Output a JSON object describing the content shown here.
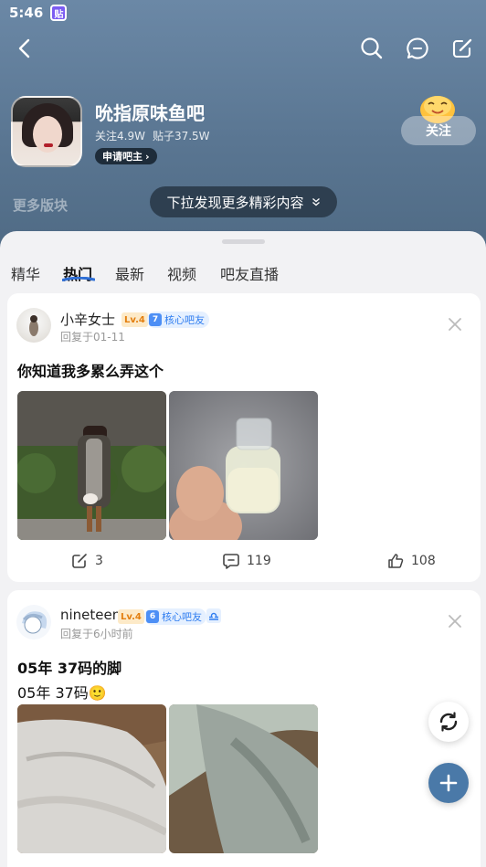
{
  "status_bar": {
    "time": "5:46"
  },
  "forum": {
    "name": "吮指原味鱼吧",
    "followers": "关注4.9W",
    "posts": "贴子37.5W",
    "apply_moderator": "申请吧主",
    "follow_label": "关注",
    "more_sections": "更多版块",
    "pull_hint": "下拉发现更多精彩内容"
  },
  "tabs": [
    "精华",
    "热门",
    "最新",
    "视频",
    "吧友直播"
  ],
  "active_tab": "热门",
  "posts": [
    {
      "username": "小辛女士",
      "level": "Lv.4",
      "core_rank": "7",
      "core_label": "核心吧友",
      "reply_time": "回复于01-11",
      "title": "你知道我多累么弄这个",
      "body": "",
      "comments": "3",
      "replies": "119",
      "likes": "108"
    },
    {
      "username": "nineteen",
      "level": "Lv.4",
      "core_rank": "6",
      "core_label": "核心吧友",
      "reply_time": "回复于6小时前",
      "title": "05年 37码的脚",
      "body": "05年 37码🙂"
    }
  ],
  "icons": {
    "back": "back-arrow-icon",
    "search": "search-icon",
    "message": "message-icon",
    "edit": "edit-icon",
    "refresh": "refresh-icon",
    "add": "plus-icon"
  },
  "colors": {
    "header_bg": "#5a7692",
    "accent_blue": "#2f7df0",
    "level_orange": "#e37f10",
    "fab_blue": "#4a79a8"
  }
}
